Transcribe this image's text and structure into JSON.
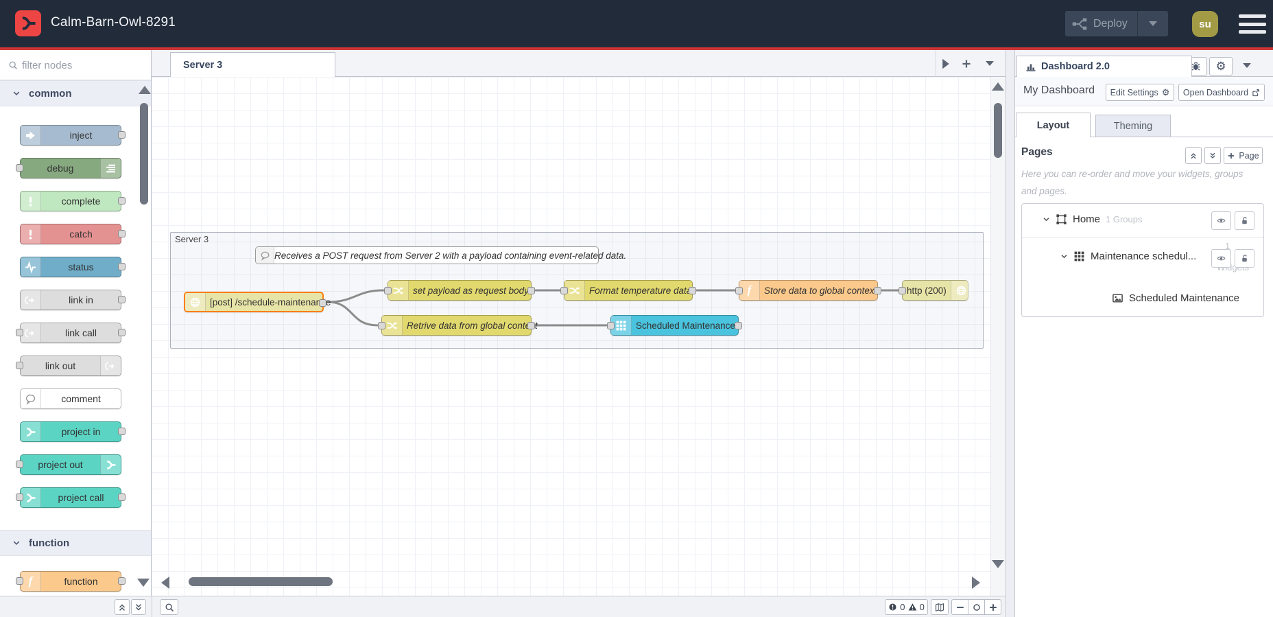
{
  "header": {
    "title": "Calm-Barn-Owl-8291",
    "deploy_label": "Deploy",
    "avatar_initials": "su"
  },
  "palette": {
    "filter_placeholder": "filter nodes",
    "categories": [
      {
        "label": "common",
        "nodes": [
          {
            "label": "inject",
            "color": "#a6bbcf",
            "icon": "inject-arrow-icon"
          },
          {
            "label": "debug",
            "color": "#87a980",
            "icon": "debug-bars-icon"
          },
          {
            "label": "complete",
            "color": "#c0e8c0",
            "icon": "exclamation-icon"
          },
          {
            "label": "catch",
            "color": "#e49191",
            "icon": "exclamation-icon"
          },
          {
            "label": "status",
            "color": "#6fadc9",
            "icon": "pulse-icon"
          },
          {
            "label": "link in",
            "color": "#dddddd",
            "icon": "link-icon"
          },
          {
            "label": "link call",
            "color": "#dddddd",
            "icon": "link-icon"
          },
          {
            "label": "link out",
            "color": "#dddddd",
            "icon": "link-icon"
          },
          {
            "label": "comment",
            "color": "#ffffff",
            "icon": "speech-bubble-icon"
          },
          {
            "label": "project in",
            "color": "#5bd4c4",
            "icon": "node-red-fork-icon"
          },
          {
            "label": "project out",
            "color": "#5bd4c4",
            "icon": "node-red-fork-icon"
          },
          {
            "label": "project call",
            "color": "#5bd4c4",
            "icon": "node-red-fork-icon"
          }
        ]
      },
      {
        "label": "function",
        "nodes": [
          {
            "label": "function",
            "color": "#fbc98c",
            "icon": "function-f-icon"
          }
        ]
      }
    ]
  },
  "workspace": {
    "tab_label": "Server 3",
    "group_label": "Server 3",
    "comment_text": "Receives a POST request from Server 2 with a payload containing event-related data.",
    "nodes": [
      {
        "label": "[post] /schedule-maintenance",
        "type": "http in",
        "color": "#e7e4a7",
        "selected": true
      },
      {
        "label": "set payload as request body",
        "type": "change",
        "color": "#e2d96e"
      },
      {
        "label": "Format temperature data.",
        "type": "change",
        "color": "#e2d96e"
      },
      {
        "label": "Store data to global context",
        "type": "function",
        "color": "#fbc98c"
      },
      {
        "label": "http (200)",
        "type": "http response",
        "color": "#e7e4a7"
      },
      {
        "label": "Retrive data from global context",
        "type": "change",
        "color": "#e2d96e"
      },
      {
        "label": "Scheduled Maintenance",
        "type": "ui-table",
        "color": "#4ac3de"
      }
    ],
    "status": {
      "error_count": "0",
      "warning_count": "0"
    }
  },
  "sidebar": {
    "tab_label": "Dashboard 2.0",
    "dashboard_name": "My Dashboard",
    "edit_settings_label": "Edit Settings",
    "open_dashboard_label": "Open Dashboard",
    "tabs": [
      {
        "label": "Layout"
      },
      {
        "label": "Theming"
      }
    ],
    "pages": {
      "title": "Pages",
      "add_page_label": "Page",
      "help_text": "Here you can re-order and move your widgets, groups and pages.",
      "tree": [
        {
          "label": "Home",
          "badge": "1 Groups"
        },
        {
          "label": "Maintenance schedul...",
          "badge_count": "1",
          "badge_unit": "Widgets"
        },
        {
          "label": "Scheduled Maintenance"
        }
      ]
    }
  },
  "colors": {
    "header_bg": "#222b3a",
    "accent_red": "#cd3537",
    "logo_red": "#ec4544",
    "selection_orange": "#ff7f0e",
    "avatar_bg": "#a39a45"
  }
}
